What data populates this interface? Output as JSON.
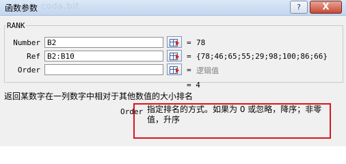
{
  "window": {
    "title": "函数参数",
    "watermark": "coda.bit"
  },
  "titlebar": {
    "help_label": "?",
    "close_label": "X"
  },
  "function": {
    "name": "RANK"
  },
  "args": [
    {
      "label": "Number",
      "value": "B2",
      "result": "78"
    },
    {
      "label": "Ref",
      "value": "B2:B10",
      "result": "{78;46;65;55;29;98;100;86;66}"
    },
    {
      "label": "Order",
      "value": "",
      "result": "逻辑值"
    }
  ],
  "equals": "=",
  "result": "4",
  "description": "返回某数字在一列数字中相对于其他数值的大小排名",
  "param_help": {
    "name": "Order",
    "text": "指定排名的方式。如果为 0 或忽略，降序；非零值，升序"
  },
  "colors": {
    "highlight": "#d9141c",
    "titlebar": "#c2d6ee",
    "close": "#c84a33"
  },
  "icons": {
    "ref_button": "collapse-dialog-icon"
  }
}
